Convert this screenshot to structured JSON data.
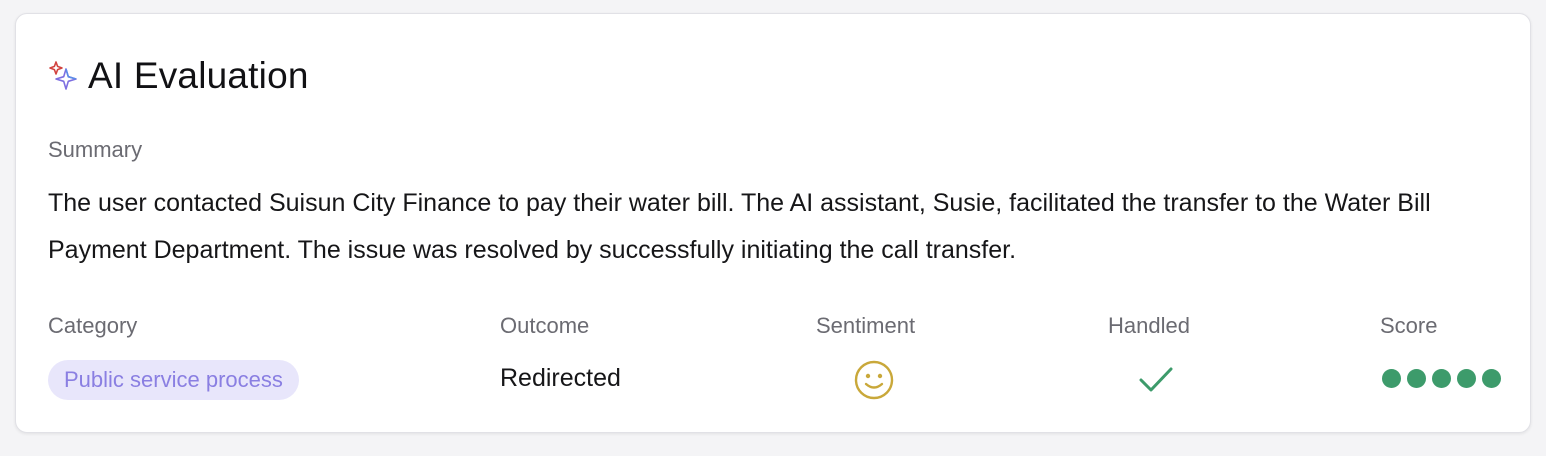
{
  "evaluation": {
    "title": "AI Evaluation",
    "title_icon": "sparkle-icon",
    "summary_label": "Summary",
    "summary_text": "The user contacted Suisun City Finance to pay their water bill. The AI assistant, Susie, facilitated the transfer to the Water Bill Payment Department. The issue was resolved by successfully initiating the call transfer."
  },
  "columns": {
    "category": {
      "label": "Category",
      "value": "Public service process"
    },
    "outcome": {
      "label": "Outcome",
      "value": "Redirected"
    },
    "sentiment": {
      "label": "Sentiment",
      "icon": "smiley-icon",
      "value": "positive"
    },
    "handled": {
      "label": "Handled",
      "icon": "check-icon",
      "value": true
    },
    "score": {
      "label": "Score",
      "value": 5,
      "max": 5
    }
  },
  "colors": {
    "chip_bg": "#e8e6fb",
    "chip_text": "#8a7fe2",
    "sentiment": "#c9a83a",
    "success": "#3d9b6b"
  }
}
